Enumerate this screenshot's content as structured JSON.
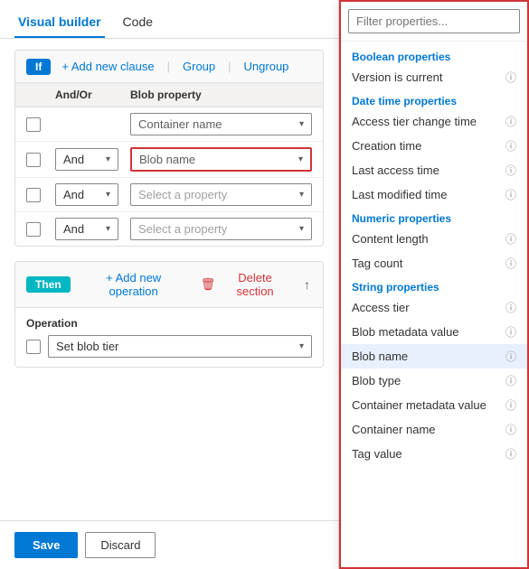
{
  "tabs": {
    "visual_builder": "Visual builder",
    "code": "Code",
    "active": "Visual builder"
  },
  "if_section": {
    "badge": "If",
    "add_clause": "+ Add new clause",
    "group": "Group",
    "ungroup": "Ungroup",
    "columns": {
      "and_or": "And/Or",
      "blob_property": "Blob property"
    },
    "rows": [
      {
        "id": 1,
        "and_or": null,
        "property": "Container name",
        "highlighted": false
      },
      {
        "id": 2,
        "and_or": "And",
        "property": "Blob name",
        "highlighted": true
      },
      {
        "id": 3,
        "and_or": "And",
        "property": "Select a property",
        "highlighted": false,
        "placeholder": true
      },
      {
        "id": 4,
        "and_or": "And",
        "property": "Select a property",
        "highlighted": false,
        "placeholder": true
      }
    ]
  },
  "then_section": {
    "badge": "Then",
    "add_operation": "+ Add new operation",
    "delete_section": "Delete section",
    "column": "Operation",
    "operation_value": "Set blob tier"
  },
  "footer": {
    "save": "Save",
    "discard": "Discard"
  },
  "dropdown": {
    "filter_placeholder": "Filter properties...",
    "categories": [
      {
        "name": "Boolean properties",
        "items": [
          {
            "label": "Version is current",
            "info": true
          }
        ]
      },
      {
        "name": "Date time properties",
        "items": [
          {
            "label": "Access tier change time",
            "info": true
          },
          {
            "label": "Creation time",
            "info": true
          },
          {
            "label": "Last access time",
            "info": true
          },
          {
            "label": "Last modified time",
            "info": true
          }
        ]
      },
      {
        "name": "Numeric properties",
        "items": [
          {
            "label": "Content length",
            "info": true
          },
          {
            "label": "Tag count",
            "info": true
          }
        ]
      },
      {
        "name": "String properties",
        "items": [
          {
            "label": "Access tier",
            "info": true
          },
          {
            "label": "Blob metadata value",
            "info": true
          },
          {
            "label": "Blob name",
            "info": true,
            "selected": true
          },
          {
            "label": "Blob type",
            "info": true
          },
          {
            "label": "Container metadata value",
            "info": true
          },
          {
            "label": "Container name",
            "info": true
          },
          {
            "label": "Tag value",
            "info": true
          }
        ]
      }
    ]
  }
}
